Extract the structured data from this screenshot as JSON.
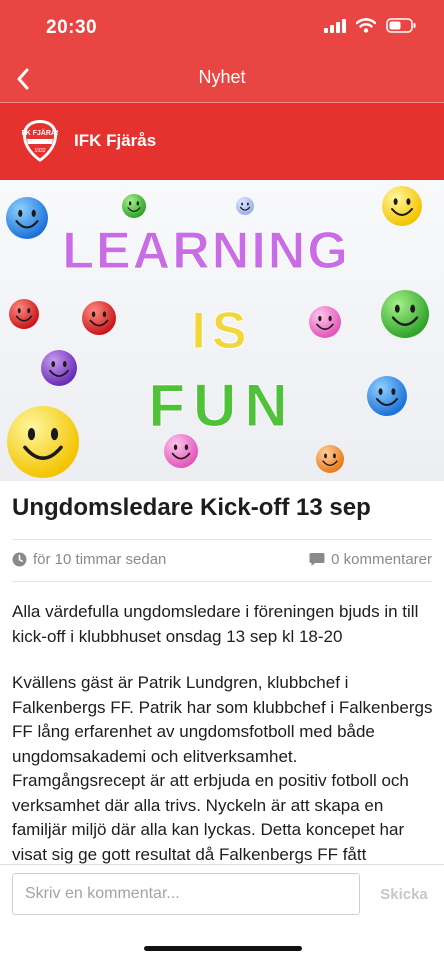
{
  "status_bar": {
    "time": "20:30"
  },
  "nav": {
    "title": "Nyhet",
    "back_icon": "chevron-left-icon"
  },
  "club": {
    "name": "IFK Fjärås",
    "logo_text": "IFK FJÄRÅS",
    "logo_year": "1932"
  },
  "hero": {
    "line1": "LEARNING",
    "line2": "IS",
    "line3": "FUN"
  },
  "article": {
    "title": "Ungdomsledare Kick-off 13 sep",
    "time_ago": "för 10 timmar sedan",
    "comments_count": "0 kommentarer",
    "paragraphs": [
      "Alla värdefulla ungdomsledare i föreningen bjuds in till kick-off i klubbhuset onsdag 13 sep kl 18-20",
      "Kvällens gäst är Patrik Lundgren, klubbchef i Falkenbergs FF. Patrik har som klubbchef i Falkenbergs FF lång erfarenhet av ungdomsfotboll med både ungdomsakademi och elitverksamhet. Framgångsrecept är att erbjuda en positiv fotboll och verksamhet där alla trivs. Nyckeln är att skapa en familjär miljö där alla kan lyckas. Detta koncepet har visat sig ge gott resultat då Falkenbergs FF fått"
    ]
  },
  "comment": {
    "placeholder": "Skriv en kommentar...",
    "send_label": "Skicka"
  },
  "colors": {
    "brand_red": "#e94542",
    "club_bar": "#e5322f"
  }
}
